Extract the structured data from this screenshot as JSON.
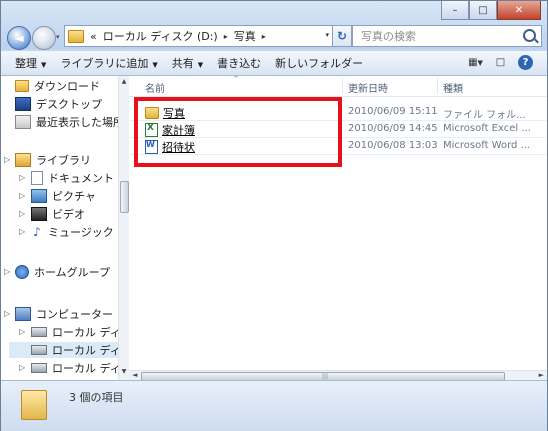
{
  "window": {
    "caption": {
      "minimize": "–",
      "maximize": "□",
      "close": "✕"
    }
  },
  "nav": {
    "back": "◄",
    "forward": "►",
    "dropdown": "▾"
  },
  "address": {
    "prefix": "«",
    "segments": [
      "ローカル ディスク (D:)",
      "写真"
    ],
    "separator": "▸",
    "dropdown": "▾",
    "refresh_icon": "↻"
  },
  "search": {
    "placeholder": "写真の検索"
  },
  "toolbar": {
    "buttons": [
      "整理",
      "ライブラリに追加",
      "共有",
      "書き込む",
      "新しいフォルダー"
    ],
    "dropdown_arrow": "▼",
    "help_label": "?"
  },
  "sidebar": {
    "items": [
      {
        "label": "ダウンロード",
        "icon": "downloads-icon"
      },
      {
        "label": "デスクトップ",
        "icon": "desktop-icon"
      },
      {
        "label": "最近表示した場所",
        "icon": "recent-places-icon"
      },
      {
        "label": "ライブラリ",
        "icon": "libraries-icon"
      },
      {
        "label": "ドキュメント",
        "icon": "documents-icon"
      },
      {
        "label": "ピクチャ",
        "icon": "pictures-icon"
      },
      {
        "label": "ビデオ",
        "icon": "videos-icon"
      },
      {
        "label": "ミュージック",
        "icon": "music-icon"
      },
      {
        "label": "ホームグループ",
        "icon": "homegroup-icon"
      },
      {
        "label": "コンピューター",
        "icon": "computer-icon"
      },
      {
        "label": "ローカル ディス",
        "icon": "drive-icon"
      },
      {
        "label": "ローカル ディス",
        "icon": "drive-icon"
      },
      {
        "label": "ローカル ディス",
        "icon": "drive-icon"
      }
    ],
    "selected_index": 11
  },
  "columns": [
    "名前",
    "更新日時",
    "種類"
  ],
  "files": [
    {
      "name": "写真",
      "modified": "2010/06/09 15:11",
      "type": "ファイル フォル...",
      "icon": "folder-icon"
    },
    {
      "name": "家計簿",
      "modified": "2010/06/09 14:45",
      "type": "Microsoft Excel ...",
      "icon": "excel-file-icon"
    },
    {
      "name": "招待状",
      "modified": "2010/06/08 13:03",
      "type": "Microsoft Word ...",
      "icon": "word-file-icon"
    }
  ],
  "highlight_color": "#e8101a",
  "status": {
    "count": "3 個の項目"
  },
  "glyphs": {
    "expand_arrow": "▷",
    "scroll_up": "▲",
    "scroll_down": "▼",
    "scroll_left": "◄",
    "scroll_right": "►",
    "grip": "|||",
    "sort_caret": "^",
    "music_note": "♪"
  }
}
